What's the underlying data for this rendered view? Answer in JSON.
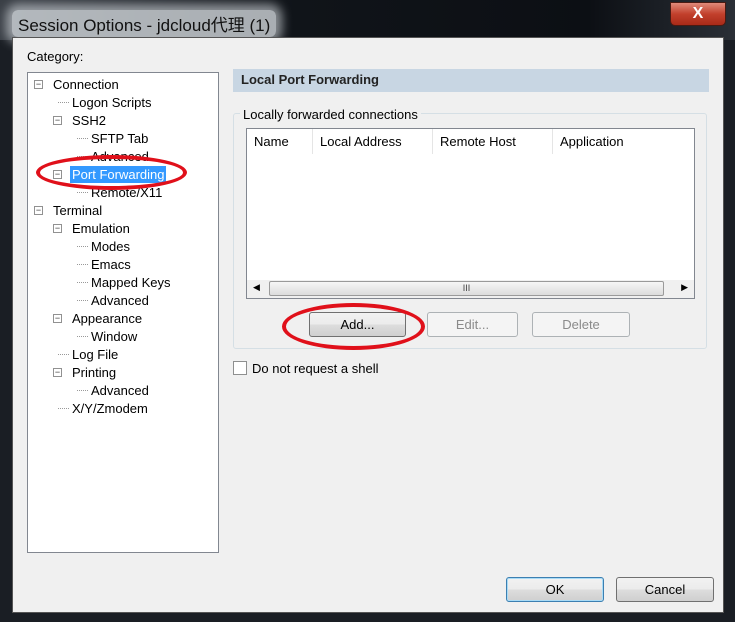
{
  "window": {
    "title": "Session Options - jdcloud代理 (1)",
    "close_label": "X"
  },
  "category_label": "Category:",
  "tree": [
    {
      "label": "Connection",
      "level": 0,
      "expander": "minus"
    },
    {
      "label": "Logon Scripts",
      "level": 1
    },
    {
      "label": "SSH2",
      "level": 1,
      "expander": "minus"
    },
    {
      "label": "SFTP Tab",
      "level": 2
    },
    {
      "label": "Advanced",
      "level": 2
    },
    {
      "label": "Port Forwarding",
      "level": 1,
      "expander": "minus",
      "selected": true
    },
    {
      "label": "Remote/X11",
      "level": 2
    },
    {
      "label": "Terminal",
      "level": 0,
      "expander": "minus"
    },
    {
      "label": "Emulation",
      "level": 1,
      "expander": "minus"
    },
    {
      "label": "Modes",
      "level": 2
    },
    {
      "label": "Emacs",
      "level": 2
    },
    {
      "label": "Mapped Keys",
      "level": 2
    },
    {
      "label": "Advanced",
      "level": 2
    },
    {
      "label": "Appearance",
      "level": 1,
      "expander": "minus"
    },
    {
      "label": "Window",
      "level": 2
    },
    {
      "label": "Log File",
      "level": 1
    },
    {
      "label": "Printing",
      "level": 1,
      "expander": "minus"
    },
    {
      "label": "Advanced",
      "level": 2
    },
    {
      "label": "X/Y/Zmodem",
      "level": 1
    }
  ],
  "panel": {
    "header": "Local Port Forwarding",
    "group_label": "Locally forwarded connections",
    "columns": [
      "Name",
      "Local Address",
      "Remote Host",
      "Application"
    ],
    "scroll_grip": "III",
    "add": "Add...",
    "edit": "Edit...",
    "delete": "Delete",
    "no_shell": "Do not request a shell"
  },
  "footer": {
    "ok": "OK",
    "cancel": "Cancel"
  },
  "annotation_color": "#e0101a"
}
